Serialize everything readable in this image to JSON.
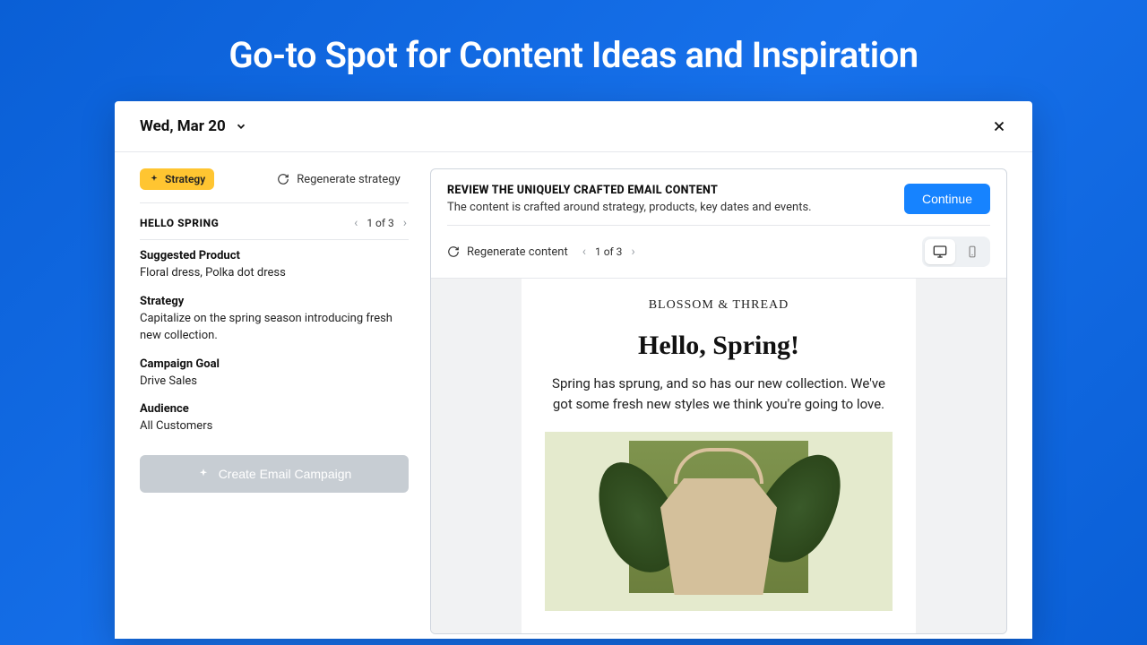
{
  "hero": "Go-to Spot for Content Ideas and Inspiration",
  "header": {
    "date": "Wed, Mar 20"
  },
  "strategy": {
    "chip": "Strategy",
    "regenerate": "Regenerate strategy",
    "title": "HELLO SPRING",
    "pager": "1 of 3",
    "fields": {
      "product_label": "Suggested Product",
      "product_value": "Floral dress, Polka dot dress",
      "strategy_label": "Strategy",
      "strategy_value": "Capitalize on the spring season introducing fresh new collection.",
      "goal_label": "Campaign Goal",
      "goal_value": "Drive Sales",
      "audience_label": "Audience",
      "audience_value": "All Customers"
    },
    "create_btn": "Create Email Campaign"
  },
  "preview": {
    "title": "REVIEW THE UNIQUELY CRAFTED EMAIL CONTENT",
    "subtitle": "The content is crafted around strategy, products, key dates and events.",
    "continue": "Continue",
    "regenerate": "Regenerate  content",
    "pager": "1 of 3",
    "email": {
      "brand": "BLOSSOM & THREAD",
      "headline": "Hello, Spring!",
      "body": "Spring has sprung, and so has our new collection. We've got some fresh new styles we think you're going to love."
    }
  }
}
